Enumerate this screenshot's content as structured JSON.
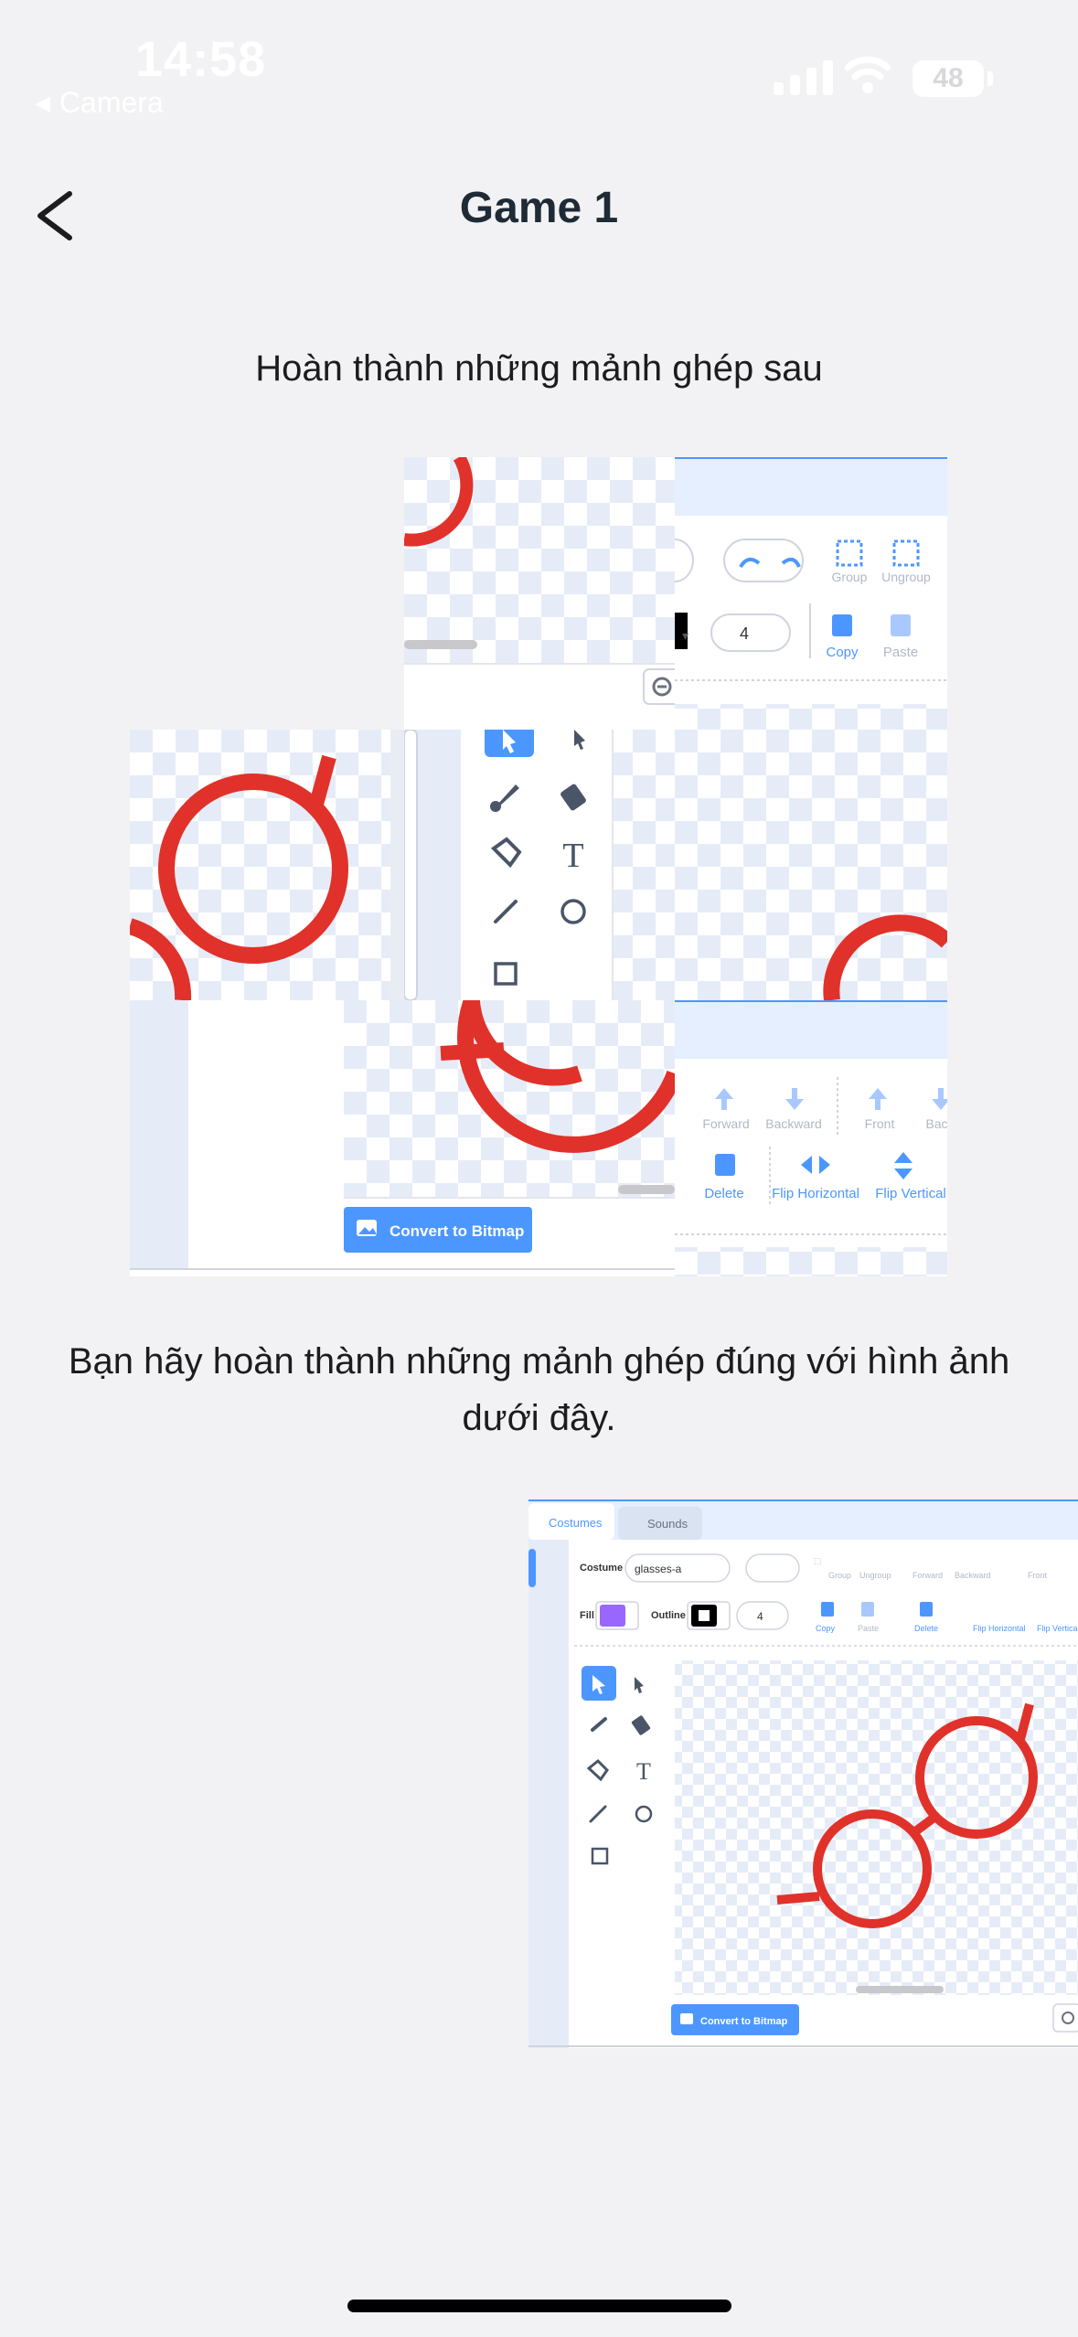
{
  "status_bar": {
    "time": "14:58",
    "back_app": "Camera",
    "battery": "48"
  },
  "header": {
    "title": "Game 1"
  },
  "instructions": {
    "top": "Hoàn thành những mảnh ghép sau",
    "bottom": "Bạn hãy hoàn thành những mảnh ghép đúng với hình ảnh dưới đây."
  },
  "editor_labels": {
    "group": "Group",
    "ungroup": "Ungroup",
    "copy": "Copy",
    "paste": "Paste",
    "delete": "Delete",
    "forward": "Forward",
    "backward": "Backward",
    "front": "Front",
    "back": "Back",
    "flip_horizontal": "Flip Horizontal",
    "flip_vertical": "Flip Vertical",
    "convert_to_bitmap": "Convert to Bitmap",
    "outline_width": "4",
    "costumes_tab": "Costumes",
    "sounds_tab": "Sounds",
    "costume_label": "Costume",
    "costume_name": "glasses-a",
    "fill_label": "Fill",
    "outline_label": "Outline"
  },
  "colors": {
    "background": "#f2f2f4",
    "accent_blue": "#4c97ff",
    "glasses_red": "#e0322a",
    "fill_purple": "#9966ff",
    "checker_light": "#e9eef8"
  },
  "icons": {
    "back": "chevron-left-icon",
    "signal": "cellular-signal-icon",
    "wifi": "wifi-icon",
    "battery": "battery-icon"
  }
}
